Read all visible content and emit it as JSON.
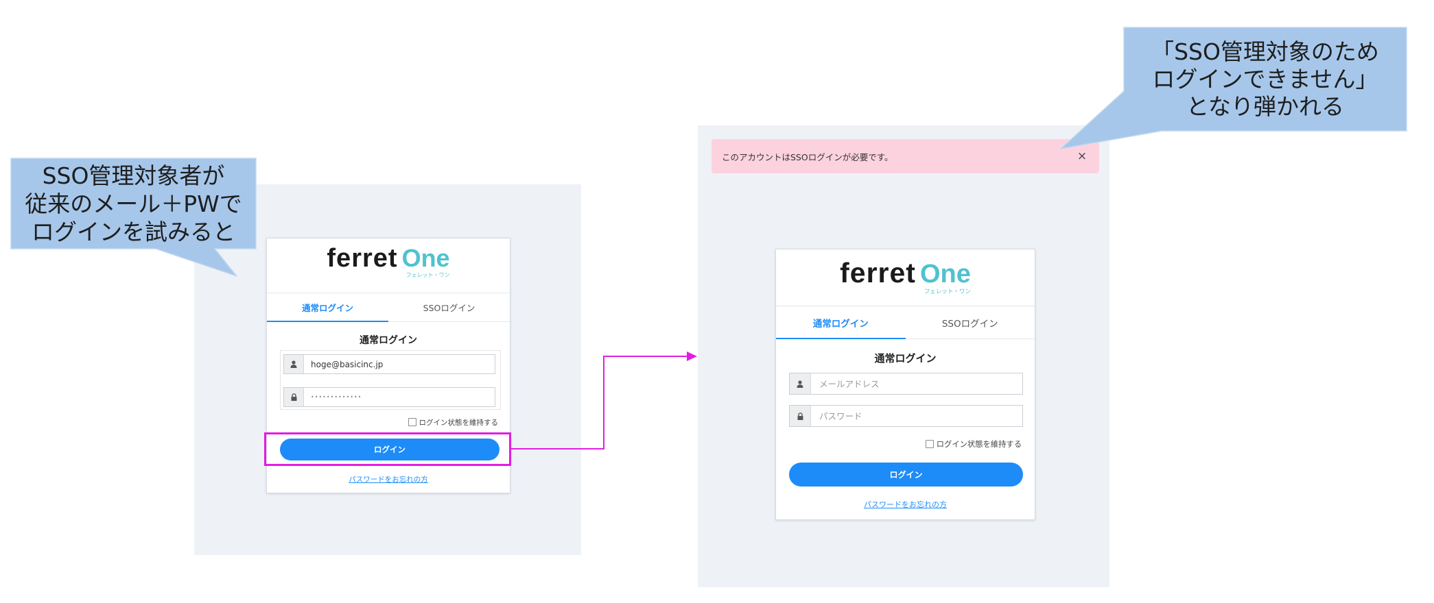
{
  "colors": {
    "callout_fill": "#a6c7ea",
    "callout_stroke": "#c2d8ef",
    "annotation_magenta": "#e21de2",
    "panel_background": "#eef2f7",
    "brand_blue": "#1d8cf8",
    "logo_teal": "#4fc2cf",
    "alert_background": "#fdd2df"
  },
  "callouts": {
    "attempt": {
      "lines": [
        "SSO管理対象者が",
        "従来のメール＋PWで",
        "ログインを試みると"
      ]
    },
    "result": {
      "lines": [
        "「SSO管理対象のため",
        "ログインできません」",
        "となり弾かれる"
      ]
    }
  },
  "before_screen": {
    "logo": {
      "word": "ferret",
      "accent": "One",
      "kana": "フェレット・ワン"
    },
    "tabs": [
      {
        "label": "通常ログイン",
        "active": true
      },
      {
        "label": "SSOログイン",
        "active": false
      }
    ],
    "form_title": "通常ログイン",
    "email_field": {
      "icon": "user-icon",
      "value": "hoge@basicinc.jp"
    },
    "password_field": {
      "icon": "lock-icon",
      "value": "•••••••••••••"
    },
    "remember_me": {
      "label": "ログイン状態を維持する",
      "checked": false
    },
    "login_button": "ログイン",
    "forgot_password_link": "パスワードをお忘れの方"
  },
  "after_screen": {
    "alert": {
      "message": "このアカウントはSSOログインが必要です。",
      "close": "×"
    },
    "logo": {
      "word": "ferret",
      "accent": "One",
      "kana": "フェレット・ワン"
    },
    "tabs": [
      {
        "label": "通常ログイン",
        "active": true
      },
      {
        "label": "SSOログイン",
        "active": false
      }
    ],
    "form_title": "通常ログイン",
    "email_field": {
      "icon": "user-icon",
      "placeholder": "メールアドレス"
    },
    "password_field": {
      "icon": "lock-icon",
      "placeholder": "パスワード"
    },
    "remember_me": {
      "label": "ログイン状態を維持する",
      "checked": false
    },
    "login_button": "ログイン",
    "forgot_password_link": "パスワードをお忘れの方"
  }
}
